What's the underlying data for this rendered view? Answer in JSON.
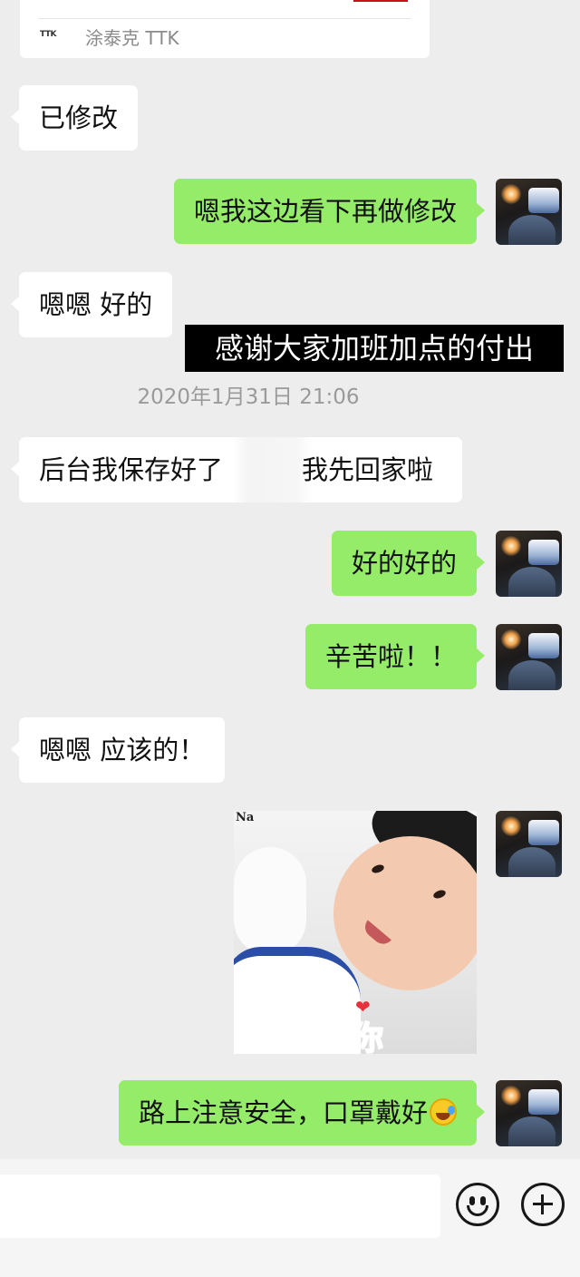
{
  "link_card": {
    "source_logo": "TTK",
    "source_name": "涂泰克 TTK"
  },
  "caption": "感谢大家加班加点的付出",
  "timestamp": "2020年1月31日 21:06",
  "messages": [
    {
      "side": "left",
      "text": "已修改"
    },
    {
      "side": "right",
      "text": "嗯我这边看下再做修改"
    },
    {
      "side": "left",
      "text": "嗯嗯 好的"
    },
    {
      "side": "left",
      "text_before": "后台我保存好了",
      "text_after": "我先回家啦"
    },
    {
      "side": "right",
      "text": "好的好的"
    },
    {
      "side": "right",
      "text": "辛苦啦！！"
    },
    {
      "side": "left",
      "text": "嗯嗯 应该的！"
    },
    {
      "side": "right",
      "sticker": {
        "watermark": "Na",
        "caption": "爱你",
        "heart": "❤"
      }
    },
    {
      "side": "right",
      "text": "路上注意安全，口罩戴好",
      "emoji": "laughing-crying-emoji"
    }
  ],
  "input_bar": {
    "emoji_icon": "smile-icon",
    "plus_icon": "plus-icon"
  },
  "colors": {
    "background": "#ededed",
    "bubble_mine": "#95ec69",
    "bubble_theirs": "#ffffff"
  }
}
